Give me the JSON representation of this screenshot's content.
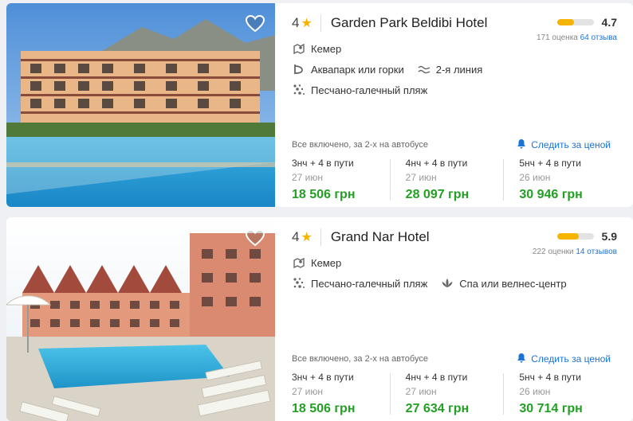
{
  "hotels": [
    {
      "stars": "4",
      "name": "Garden Park Beldibi Hotel",
      "rating": {
        "score": "4.7",
        "fraction": 0.47,
        "count": "171 оценка",
        "reviews": "64 отзыва"
      },
      "location": "Кемер",
      "features": [
        "Аквапарк или горки",
        "2-я линия"
      ],
      "beach": "Песчано-галечный пляж",
      "tour": "Все включено, за 2-х на автобусе",
      "follow": "Следить за ценой",
      "offers": [
        {
          "nights": "3нч + 4 в пути",
          "date": "27 июн",
          "price": "18 506 грн"
        },
        {
          "nights": "4нч + 4 в пути",
          "date": "27 июн",
          "price": "28 097 грн"
        },
        {
          "nights": "5нч + 4 в пути",
          "date": "26 июн",
          "price": "30 946 грн"
        }
      ]
    },
    {
      "stars": "4",
      "name": "Grand Nar Hotel",
      "rating": {
        "score": "5.9",
        "fraction": 0.59,
        "count": "222 оценки",
        "reviews": "14 отзывов"
      },
      "location": "Кемер",
      "features": [
        "Песчано-галечный пляж",
        "Спа или велнес-центр"
      ],
      "tour": "Все включено, за 2-х на автобусе",
      "follow": "Следить за ценой",
      "offers": [
        {
          "nights": "3нч + 4 в пути",
          "date": "27 июн",
          "price": "18 506 грн"
        },
        {
          "nights": "4нч + 4 в пути",
          "date": "27 июн",
          "price": "27 634 грн"
        },
        {
          "nights": "5нч + 4 в пути",
          "date": "26 июн",
          "price": "30 714 грн"
        }
      ]
    }
  ],
  "colors": {
    "accent": "#1b73d8",
    "price": "#21a023",
    "star": "#f5b400"
  }
}
